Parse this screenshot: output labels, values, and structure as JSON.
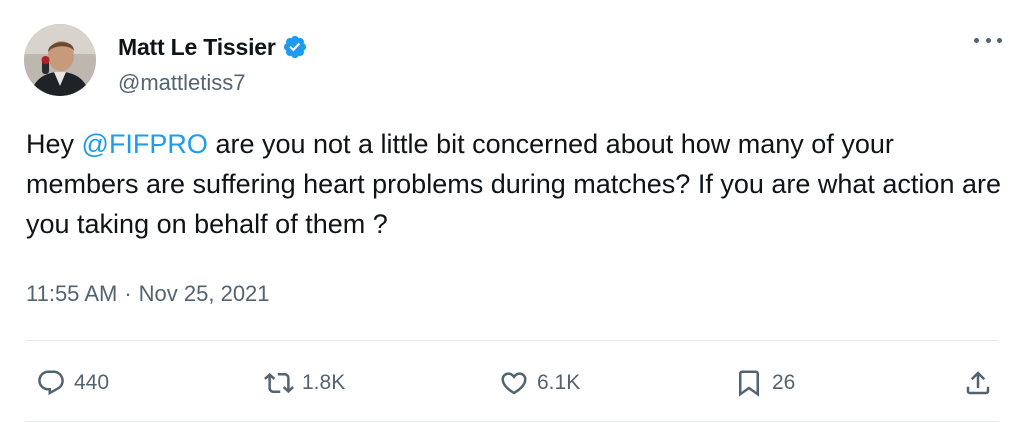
{
  "author": {
    "display_name": "Matt Le Tissier",
    "handle": "@mattletiss7",
    "verified": true,
    "verified_color": "#1d9bf0"
  },
  "tweet": {
    "text_before_mention": "Hey ",
    "mention": "@FIFPRO",
    "text_after_mention": " are you not a little bit concerned about how many of your members are suffering heart problems during matches? If you are what action are you taking on behalf of them ?",
    "time": "11:55 AM",
    "separator": "·",
    "date": "Nov 25, 2021"
  },
  "actions": {
    "reply": {
      "icon": "reply-icon",
      "count": "440"
    },
    "retweet": {
      "icon": "retweet-icon",
      "count": "1.8K"
    },
    "like": {
      "icon": "heart-icon",
      "count": "6.1K"
    },
    "bookmark": {
      "icon": "bookmark-icon",
      "count": "26"
    },
    "share": {
      "icon": "share-icon"
    }
  },
  "colors": {
    "text": "#0f1419",
    "secondary": "#536471",
    "accent": "#1d9bf0",
    "divider": "#e6ebee"
  }
}
